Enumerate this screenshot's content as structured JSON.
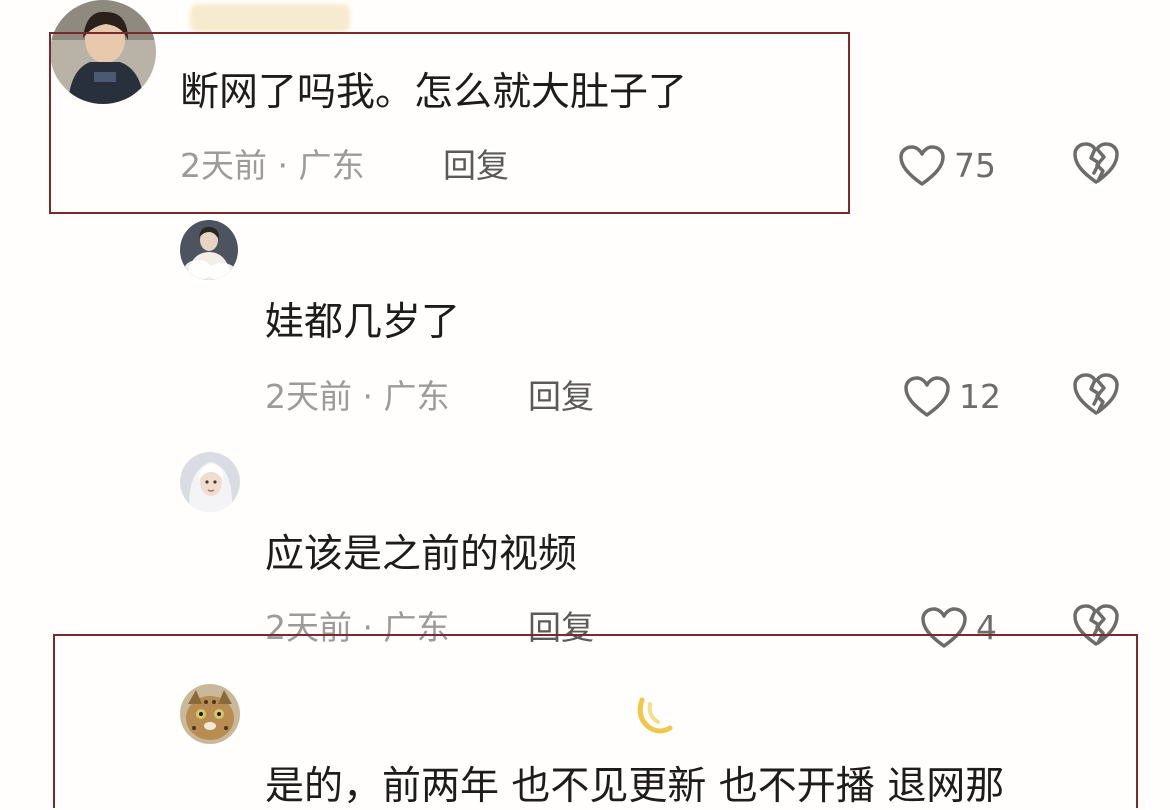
{
  "comments": [
    {
      "text": "断网了吗我。怎么就大肚子了",
      "time_location": "2天前 · 广东",
      "reply_label": "回复",
      "likes": "75",
      "level": "top"
    },
    {
      "text": "娃都几岁了",
      "time_location": "2天前 · 广东",
      "reply_label": "回复",
      "likes": "12",
      "level": "reply"
    },
    {
      "text": "应该是之前的视频",
      "time_location": "2天前 · 广东",
      "reply_label": "回复",
      "likes": "4",
      "level": "reply"
    },
    {
      "text": "是的，前两年 也不见更新 也不开播 退网那",
      "level": "reply"
    }
  ],
  "icons": {
    "like": "heart-outline-icon",
    "dislike": "broken-heart-icon"
  },
  "colors": {
    "highlight_border": "#7a2a2a",
    "meta_text": "#9b9b9b",
    "icon_stroke": "#6c6c6c"
  }
}
